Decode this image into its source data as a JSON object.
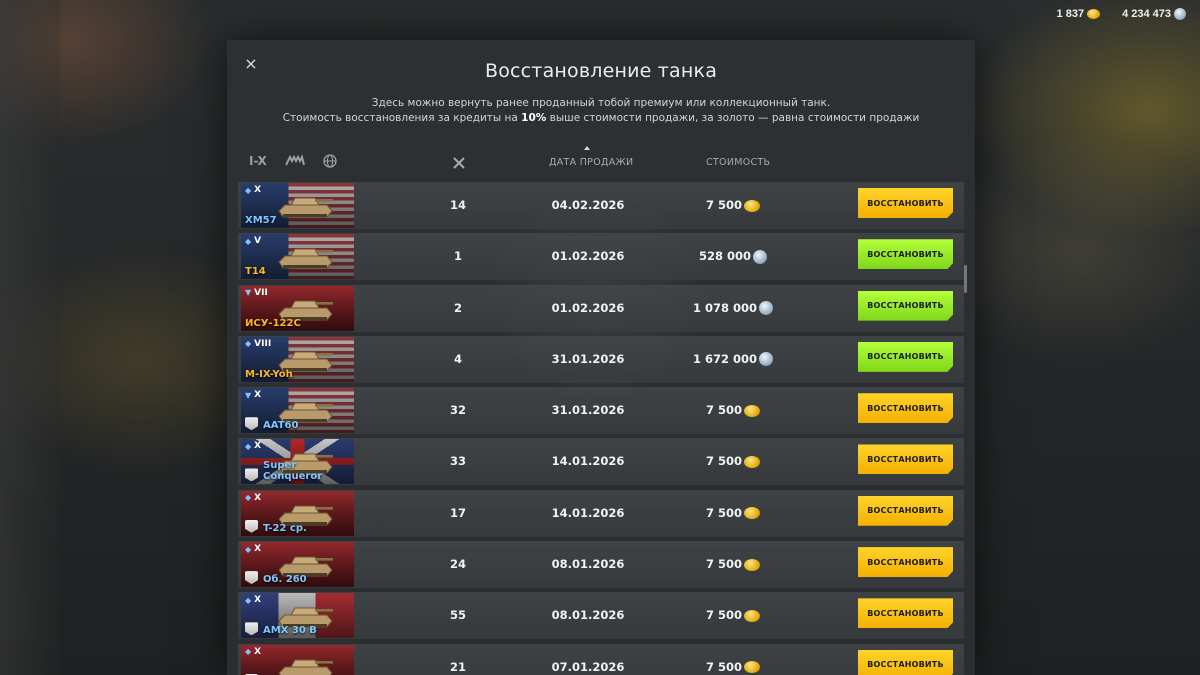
{
  "currency": {
    "gold": "1 837",
    "credits": "4 234 473"
  },
  "modal": {
    "close_label": "×",
    "title": "Восстановление танка",
    "desc_line1": "Здесь можно вернуть ранее проданный тобой премиум или коллекционный танк.",
    "desc_line2_pre": "Стоимость восстановления за кредиты на ",
    "desc_line2_bold": "10%",
    "desc_line2_post": " выше стоимости продажи, за золото — равна стоимости продажи"
  },
  "filters": {
    "tier": "I-X",
    "type_icon": "tank-type-icon",
    "nation_icon": "globe-icon"
  },
  "columns": {
    "battles_icon": "crossed-swords-icon",
    "date": "ДАТА ПРОДАЖИ",
    "cost": "СТОИМОСТЬ"
  },
  "rows": [
    {
      "tier": "X",
      "class": "med",
      "flag": "us",
      "name": "XM57",
      "name_color": "blue",
      "collect": false,
      "battles": "14",
      "date": "04.02.2026",
      "cost": "7 500",
      "currency": "gold",
      "btn": "ВОССТАНОВИТЬ",
      "btn_color": "gold"
    },
    {
      "tier": "V",
      "class": "heavy",
      "flag": "us",
      "name": "T14",
      "name_color": "gold",
      "collect": false,
      "battles": "1",
      "date": "01.02.2026",
      "cost": "528 000",
      "currency": "silver",
      "btn": "ВОССТАНОВИТЬ",
      "btn_color": "green"
    },
    {
      "tier": "VII",
      "class": "td",
      "flag": "ussr",
      "name": "ИСУ-122С",
      "name_color": "gold",
      "collect": false,
      "battles": "2",
      "date": "01.02.2026",
      "cost": "1 078 000",
      "currency": "silver",
      "btn": "ВОССТАНОВИТЬ",
      "btn_color": "green"
    },
    {
      "tier": "VIII",
      "class": "heavy",
      "flag": "us",
      "name": "M-IX-Yoh",
      "name_color": "gold",
      "collect": false,
      "battles": "4",
      "date": "31.01.2026",
      "cost": "1 672 000",
      "currency": "silver",
      "btn": "ВОССТАНОВИТЬ",
      "btn_color": "green"
    },
    {
      "tier": "X",
      "class": "td",
      "flag": "us",
      "name": "AAT60",
      "name_color": "blue",
      "collect": true,
      "battles": "32",
      "date": "31.01.2026",
      "cost": "7 500",
      "currency": "gold",
      "btn": "ВОССТАНОВИТЬ",
      "btn_color": "gold"
    },
    {
      "tier": "X",
      "class": "heavy",
      "flag": "uk",
      "name": "Super Conqueror",
      "name_color": "blue",
      "collect": true,
      "battles": "33",
      "date": "14.01.2026",
      "cost": "7 500",
      "currency": "gold",
      "btn": "ВОССТАНОВИТЬ",
      "btn_color": "gold"
    },
    {
      "tier": "X",
      "class": "med",
      "flag": "ussr",
      "name": "T-22 ср.",
      "name_color": "blue",
      "collect": true,
      "battles": "17",
      "date": "14.01.2026",
      "cost": "7 500",
      "currency": "gold",
      "btn": "ВОССТАНОВИТЬ",
      "btn_color": "gold"
    },
    {
      "tier": "X",
      "class": "heavy",
      "flag": "ussr",
      "name": "Об. 260",
      "name_color": "blue",
      "collect": true,
      "battles": "24",
      "date": "08.01.2026",
      "cost": "7 500",
      "currency": "gold",
      "btn": "ВОССТАНОВИТЬ",
      "btn_color": "gold"
    },
    {
      "tier": "X",
      "class": "heavy",
      "flag": "fr",
      "name": "AMX 30 B",
      "name_color": "blue",
      "collect": true,
      "battles": "55",
      "date": "08.01.2026",
      "cost": "7 500",
      "currency": "gold",
      "btn": "ВОССТАНОВИТЬ",
      "btn_color": "gold"
    },
    {
      "tier": "X",
      "class": "heavy",
      "flag": "ussr",
      "name": "",
      "name_color": "blue",
      "collect": true,
      "battles": "21",
      "date": "07.01.2026",
      "cost": "7 500",
      "currency": "gold",
      "btn": "ВОССТАНОВИТЬ",
      "btn_color": "gold"
    }
  ],
  "colors": {
    "gold_button": "#ffcc1a",
    "green_button": "#9aee2a",
    "tank_name_blue": "#7ec8ff",
    "tank_name_gold": "#ffb629"
  }
}
